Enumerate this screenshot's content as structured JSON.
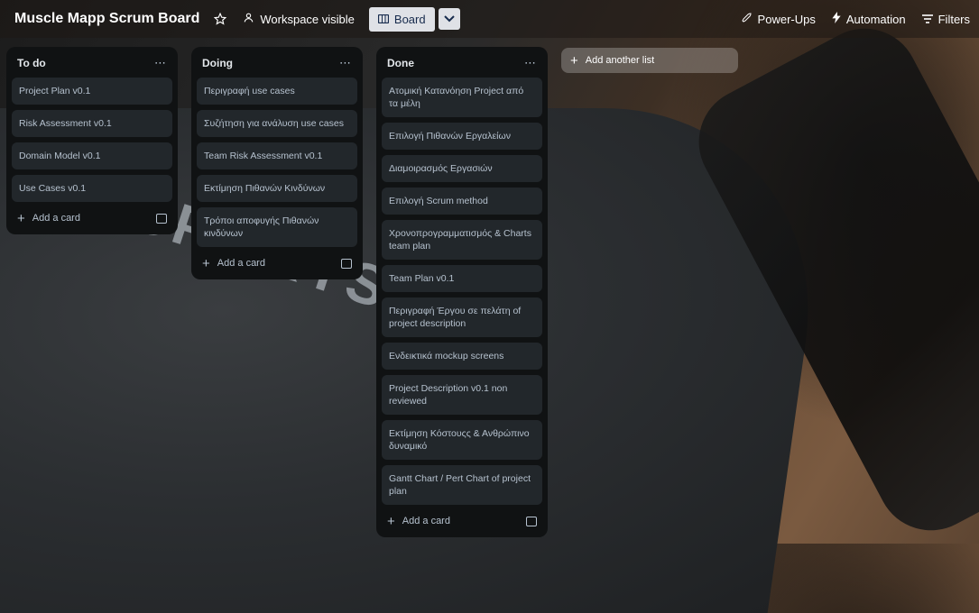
{
  "header": {
    "title": "Muscle Mapp Scrum Board",
    "star_icon": "star-icon",
    "visibility": "Workspace visible",
    "view_label": "Board",
    "power_ups": "Power-Ups",
    "automation": "Automation",
    "filters": "Filters"
  },
  "background_text": "SPORTS",
  "lists": [
    {
      "title": "To do",
      "cards": [
        "Project Plan v0.1",
        "Risk Assessment v0.1",
        "Domain Model v0.1",
        "Use Cases v0.1"
      ],
      "add_card": "Add a card"
    },
    {
      "title": "Doing",
      "cards": [
        "Περιγραφή use cases",
        "Συζήτηση για ανάλυση use cases",
        "Team Risk Assessment v0.1",
        "Εκτίμηση Πιθανών Κινδύνων",
        "Τρόποι αποφυγής Πιθανών κινδύνων"
      ],
      "add_card": "Add a card"
    },
    {
      "title": "Done",
      "cards": [
        "Ατομική Κατανόηση Project από τα μέλη",
        "Επιλογή Πιθανών Εργαλείων",
        "Διαμοιρασμός Εργασιών",
        "Επιλογή Scrum method",
        "Χρονοπρογραμματισμός & Charts team plan",
        "Team Plan v0.1",
        "Περιγραφή Έργου σε πελάτη of project description",
        "Ενδεικτικά mockup screens",
        "Project Description v0.1 non reviewed",
        "Εκτίμηση Κόστουςς & Ανθρώπινο δυναμικό",
        "Gantt Chart / Pert Chart of project plan"
      ],
      "add_card": "Add a card"
    }
  ],
  "add_list": "Add another list"
}
